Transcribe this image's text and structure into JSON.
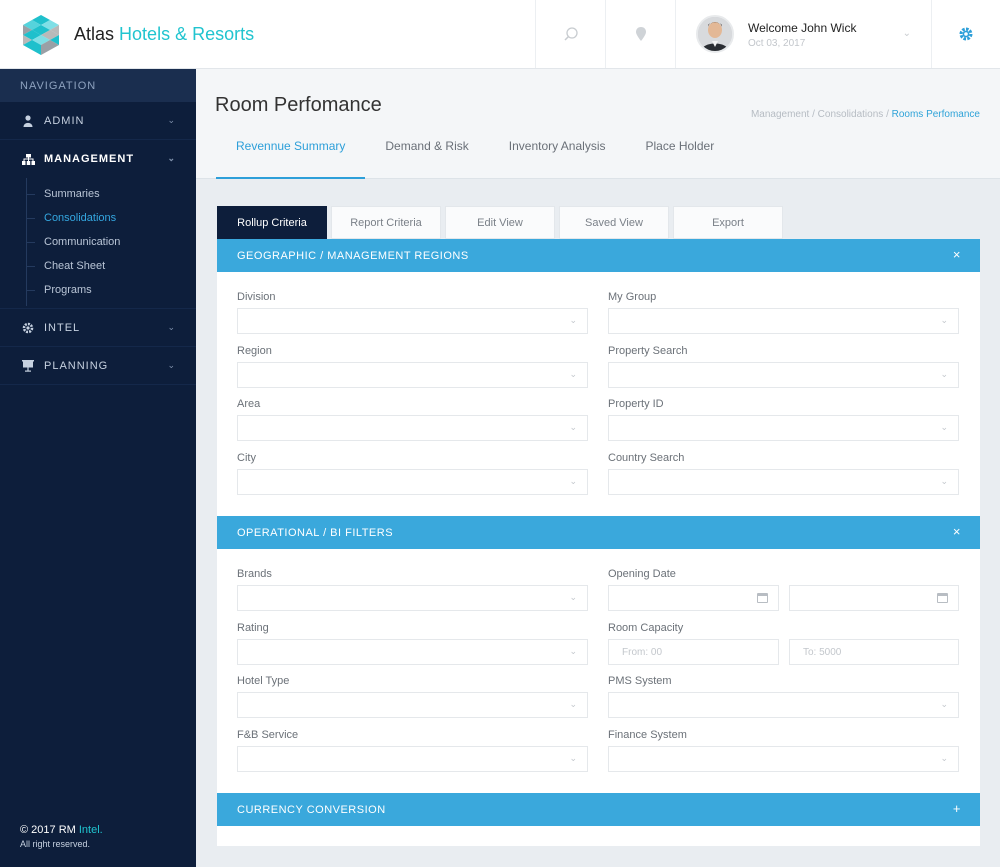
{
  "header": {
    "brand_primary": "Atlas",
    "brand_secondary": "Hotels & Resorts",
    "welcome": "Welcome John Wick",
    "date": "Oct 03, 2017",
    "icons": [
      "search-icon",
      "location-pin-icon",
      "chevron-down-icon",
      "gear-icon"
    ]
  },
  "sidebar": {
    "title": "NAVIGATION",
    "items": [
      {
        "label": "ADMIN",
        "icon": "user-icon"
      },
      {
        "label": "MANAGEMENT",
        "icon": "sitemap-icon"
      },
      {
        "label": "INTEL",
        "icon": "gear-icon"
      },
      {
        "label": "PLANNING",
        "icon": "presentation-icon"
      }
    ],
    "subitems": [
      "Summaries",
      "Consolidations",
      "Communication",
      "Cheat Sheet",
      "Programs"
    ],
    "current_subitem": "Consolidations",
    "footer_prefix": "© 2017 RM",
    "footer_accent": "Intel.",
    "footer_rights": "All right reserved."
  },
  "page": {
    "title": "Room Perfomance",
    "breadcrumb": [
      "Management",
      "Consolidations",
      "Rooms Perfomance"
    ],
    "tabs": [
      "Revennue Summary",
      "Demand & Risk",
      "Inventory Analysis",
      "Place Holder"
    ],
    "active_tab": "Revennue Summary"
  },
  "subtabs": [
    "Rollup Criteria",
    "Report Criteria",
    "Edit View",
    "Saved View",
    "Export"
  ],
  "active_subtab": "Rollup Criteria",
  "sections": {
    "geo": {
      "title": "GEOGRAPHIC / MANAGEMENT REGIONS",
      "control": "×",
      "fields": [
        "Division",
        "My Group",
        "Region",
        "Property Search",
        "Area",
        "Property ID",
        "City",
        "Country Search"
      ]
    },
    "ops": {
      "title": "OPERATIONAL / BI FILTERS",
      "control": "×",
      "fields": [
        "Brands",
        "Opening Date",
        "Rating",
        "Room Capacity",
        "Hotel Type",
        "PMS System",
        "F&B Service",
        "Finance System"
      ],
      "capacity_from_placeholder": "From: 00",
      "capacity_to_placeholder": "To: 5000"
    },
    "currency": {
      "title": "CURRENCY CONVERSION",
      "control": "+"
    }
  },
  "colors": {
    "sidebar": "#0d1e3b",
    "accent": "#3aa8dc",
    "brand_accent": "#20c4cf"
  }
}
